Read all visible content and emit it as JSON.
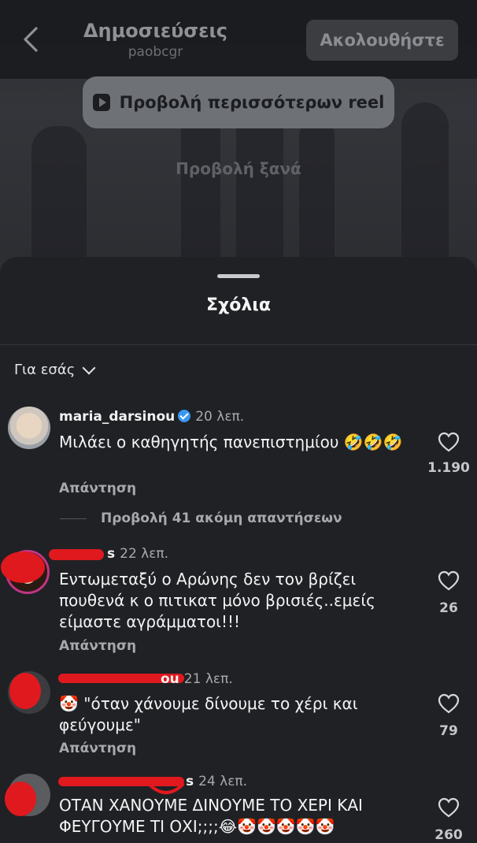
{
  "header": {
    "title": "Δημοσιεύσεις",
    "subtitle": "paobcgr",
    "follow_label": "Ακολουθήστε"
  },
  "video": {
    "more_reels_label": "Προβολή περισσότερων reel",
    "replay_label": "Προβολή ξανά"
  },
  "sheet": {
    "title": "Σχόλια",
    "filter_label": "Για εσάς"
  },
  "comments": [
    {
      "username": "maria_darsinou",
      "verified": true,
      "time": "20 λεπ.",
      "text": "Μιλάει ο καθηγητής πανεπιστημίου 🤣🤣🤣",
      "reply_label": "Απάντηση",
      "likes": "1.190",
      "view_replies": "Προβολή 41 ακόμη απαντήσεων"
    },
    {
      "username_visible": "s",
      "time": "22 λεπ.",
      "text": "Εντωμεταξύ ο Αρώνης δεν τον βρίζει πουθενά κ ο πιτικατ μόνο βρισιές..εμείς είμαστε αγράμματοι!!!",
      "reply_label": "Απάντηση",
      "likes": "26"
    },
    {
      "username_visible": "ou",
      "time": "21 λεπ.",
      "text": "🤡 \"όταν χάνουμε δίνουμε το χέρι και φεύγουμε\"",
      "reply_label": "Απάντηση",
      "likes": "79"
    },
    {
      "username_visible": "s",
      "time": "24 λεπ.",
      "text": "ΟΤΑΝ ΧΑΝΟΥΜΕ ΔΙΝΟΥΜΕ ΤΟ ΧΕΡΙ ΚΑΙ ΦΕΥΓΟΥΜΕ ΤΙ ΟΧΙ;;;;😂🤡🤡🤡🤡🤡",
      "likes": "260"
    }
  ]
}
